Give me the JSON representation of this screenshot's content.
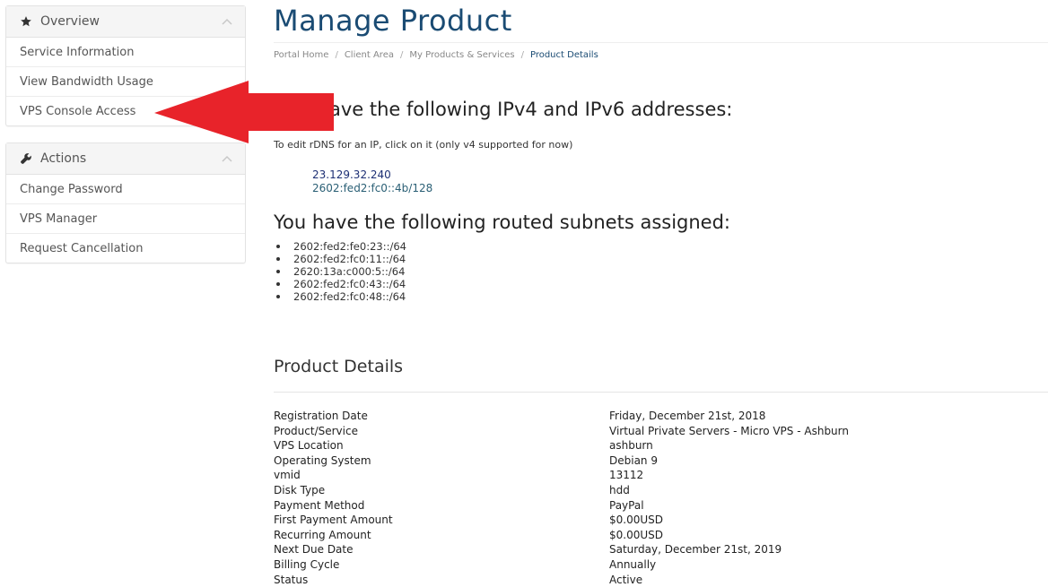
{
  "sidebar": {
    "overview": {
      "title": "Overview",
      "icon": "star-icon",
      "items": [
        {
          "label": "Service Information"
        },
        {
          "label": "View Bandwidth Usage"
        },
        {
          "label": "VPS Console Access"
        }
      ]
    },
    "actions": {
      "title": "Actions",
      "icon": "wrench-icon",
      "items": [
        {
          "label": "Change Password"
        },
        {
          "label": "VPS Manager"
        },
        {
          "label": "Request Cancellation"
        }
      ]
    }
  },
  "page": {
    "title": "Manage Product",
    "breadcrumb": [
      "Portal Home",
      "Client Area",
      "My Products & Services",
      "Product Details"
    ],
    "addresses_heading": "ave the following IPv4 and IPv6 addresses:",
    "rdns_note": "To edit rDNS for an IP, click on it (only v4 supported for now)",
    "ipv4": "23.129.32.240",
    "ipv6": "2602:fed2:fc0::4b/128",
    "subnets_heading": "You have the following routed subnets assigned:",
    "subnets": [
      "2602:fed2:fe0:23::/64",
      "2602:fed2:fc0:11::/64",
      "2620:13a:c000:5::/64",
      "2602:fed2:fc0:43::/64",
      "2602:fed2:fc0:48::/64"
    ],
    "details_heading": "Product Details",
    "details": [
      {
        "label": "Registration Date",
        "value": "Friday, December 21st, 2018"
      },
      {
        "label": "Product/Service",
        "value": "Virtual Private Servers - Micro VPS - Ashburn"
      },
      {
        "label": "VPS Location",
        "value": "ashburn"
      },
      {
        "label": "Operating System",
        "value": "Debian 9"
      },
      {
        "label": "vmid",
        "value": "13112"
      },
      {
        "label": "Disk Type",
        "value": "hdd"
      },
      {
        "label": "Payment Method",
        "value": "PayPal"
      },
      {
        "label": "First Payment Amount",
        "value": "$0.00USD"
      },
      {
        "label": "Recurring Amount",
        "value": "$0.00USD"
      },
      {
        "label": "Next Due Date",
        "value": "Saturday, December 21st, 2019"
      },
      {
        "label": "Billing Cycle",
        "value": "Annually"
      },
      {
        "label": "Status",
        "value": "Active"
      }
    ]
  },
  "colors": {
    "title": "#1a4b73",
    "link": "#1d2f74",
    "arrow": "#e8232a"
  }
}
